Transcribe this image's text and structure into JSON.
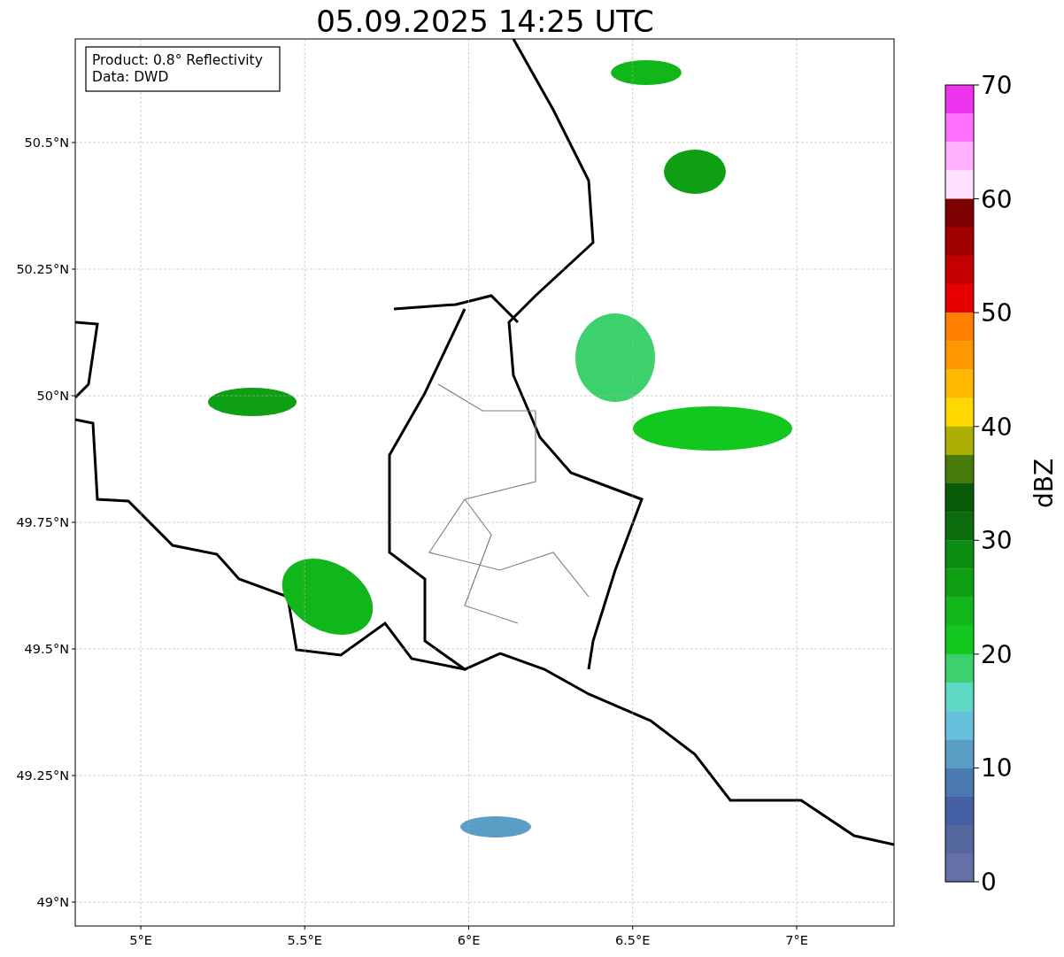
{
  "title": "05.09.2025 14:25 UTC",
  "info_box": {
    "lines": [
      "Product: 0.8° Reflectivity",
      "Data: DWD"
    ]
  },
  "map": {
    "y_ticks": [
      "50.5°N",
      "50.25°N",
      "50°N",
      "49.75°N",
      "49.5°N",
      "49.25°N",
      "49°N"
    ],
    "x_ticks": [
      "5°E",
      "5.5°E",
      "6°E",
      "6.5°E",
      "7°E"
    ]
  },
  "colorbar": {
    "label": "dBZ",
    "ticks": [
      "70",
      "60",
      "50",
      "40",
      "30",
      "20",
      "10",
      "0"
    ],
    "segments": [
      {
        "color": "#ee33ee"
      },
      {
        "color": "#ff70ff"
      },
      {
        "color": "#ffb0ff"
      },
      {
        "color": "#ffe0ff"
      },
      {
        "color": "#7d0000"
      },
      {
        "color": "#a00000"
      },
      {
        "color": "#c40000"
      },
      {
        "color": "#e60000"
      },
      {
        "color": "#ff7f00"
      },
      {
        "color": "#ff9800"
      },
      {
        "color": "#ffb800"
      },
      {
        "color": "#ffd800"
      },
      {
        "color": "#acb005"
      },
      {
        "color": "#467a0a"
      },
      {
        "color": "#085a08"
      },
      {
        "color": "#0b6c0c"
      },
      {
        "color": "#0d8c12"
      },
      {
        "color": "#0f9f15"
      },
      {
        "color": "#11b71a"
      },
      {
        "color": "#12c71d"
      },
      {
        "color": "#3dd16d"
      },
      {
        "color": "#5cd8c4"
      },
      {
        "color": "#66c2dc"
      },
      {
        "color": "#5a9ec6"
      },
      {
        "color": "#4a79b0"
      },
      {
        "color": "#4560a4"
      },
      {
        "color": "#55679f"
      },
      {
        "color": "#6470a6"
      }
    ]
  }
}
